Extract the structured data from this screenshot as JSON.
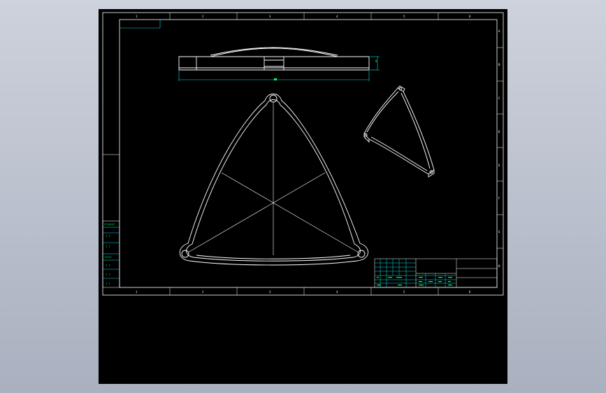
{
  "colors": {
    "background": "#000000",
    "outline": "#ffffff",
    "dimension": "#00e5e5",
    "annotation": "#00ff66",
    "page_gradient_top": "#cdd2dc",
    "page_gradient_bottom": "#a9b0bf"
  },
  "frame": {
    "zone_numbers_top": [
      "1",
      "2",
      "3",
      "4",
      "5",
      "6"
    ],
    "zone_numbers_bottom": [
      "1",
      "2",
      "3",
      "4",
      "5",
      "6"
    ],
    "zone_letters_right": [
      "A",
      "B",
      "C",
      "D",
      "E",
      "F",
      "G",
      "H"
    ]
  },
  "side_table": {
    "rows": [
      "2714127",
      "7 7",
      "7 7",
      "T1271",
      "7 7",
      "7 7",
      "7 7"
    ]
  },
  "dimensions": {
    "height_value": "8"
  }
}
